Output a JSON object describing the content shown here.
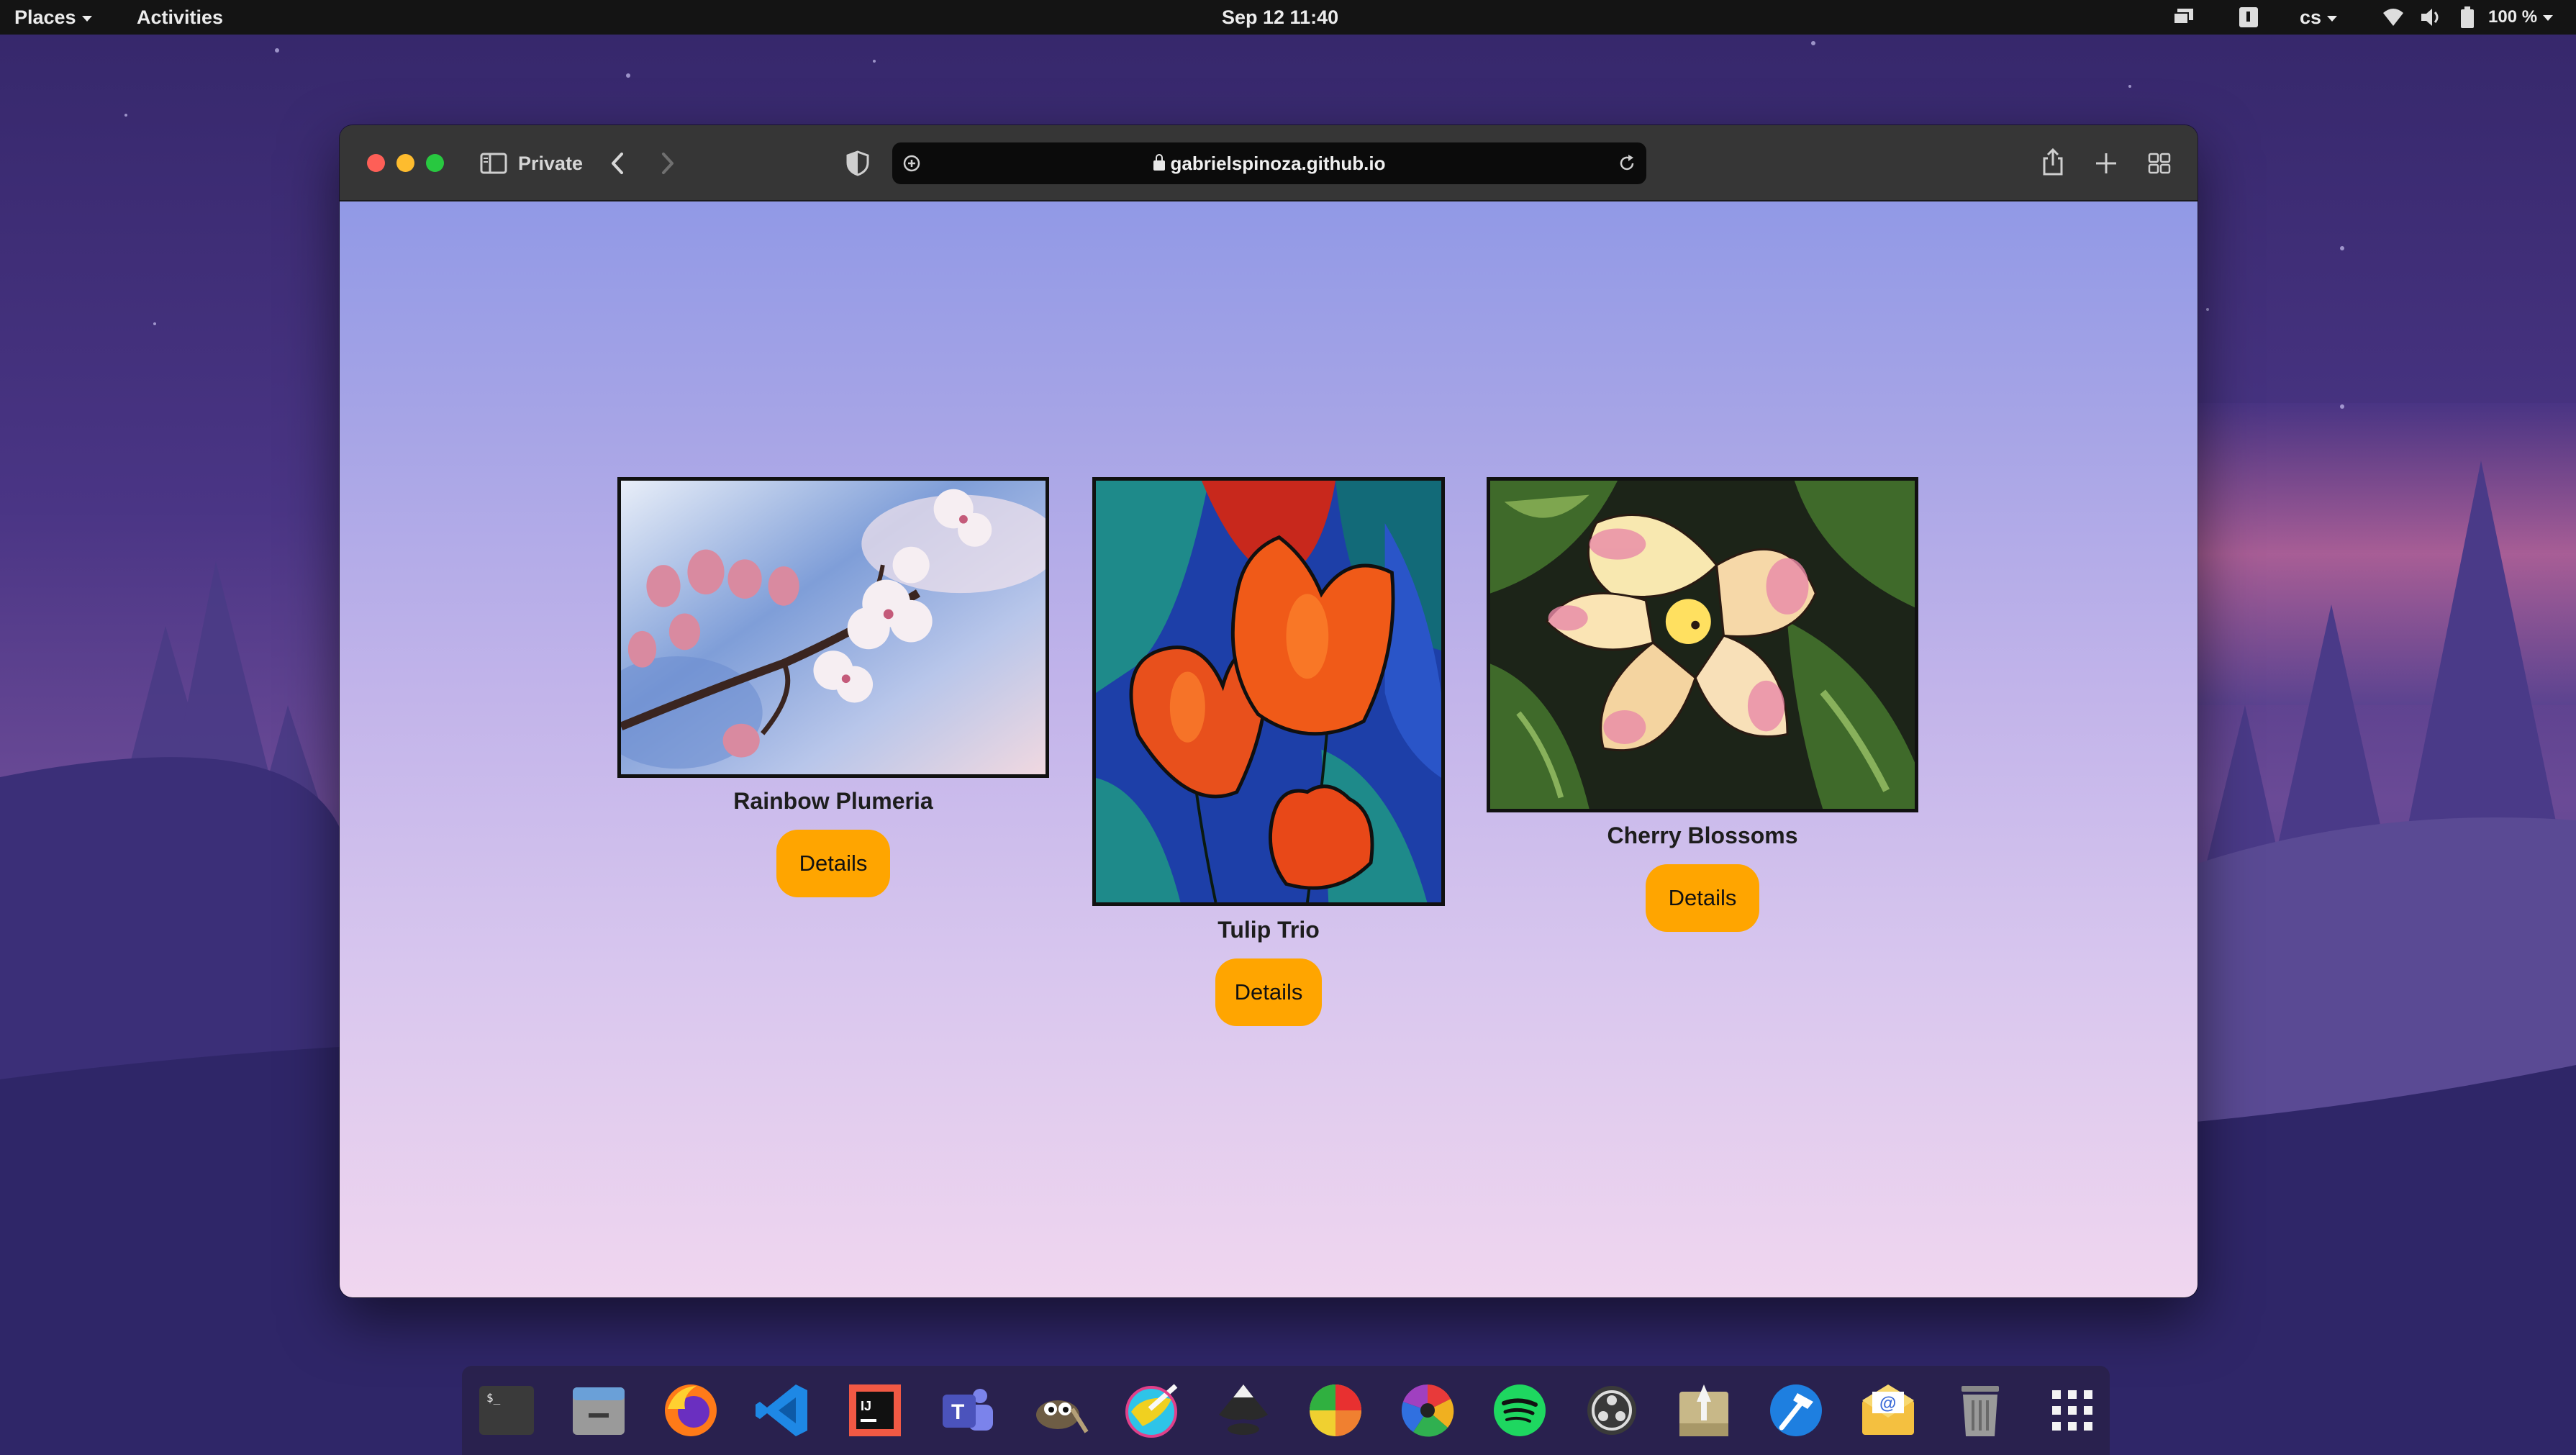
{
  "topbar": {
    "places_label": "Places",
    "activities_label": "Activities",
    "datetime": "Sep 12  11:40",
    "keyboard_layout": "cs",
    "battery_percent": "100 %",
    "icons": [
      "screens-icon",
      "notification-icon",
      "keyboard-layout-icon",
      "wifi-icon",
      "volume-icon",
      "battery-icon"
    ]
  },
  "browser": {
    "mode_label": "Private",
    "url": "gabrielspinoza.github.io",
    "toolbar_icons": [
      "sidebar-icon",
      "back-icon",
      "forward-icon",
      "privacy-shield-icon",
      "reload-icon",
      "share-icon",
      "new-tab-icon",
      "tab-overview-icon"
    ]
  },
  "gallery": {
    "items": [
      {
        "title": "Rainbow Plumeria",
        "button_label": "Details"
      },
      {
        "title": "Tulip Trio",
        "button_label": "Details"
      },
      {
        "title": "Cherry Blossoms",
        "button_label": "Details"
      }
    ]
  },
  "dock": {
    "apps": [
      "terminal-icon",
      "files-icon",
      "firefox-icon",
      "vscode-icon",
      "intellij-icon",
      "teams-icon",
      "gimp-icon",
      "krita-icon",
      "inkscape-icon",
      "color-picker-icon",
      "shotwell-icon",
      "spotify-icon",
      "obs-icon",
      "app-installer-icon",
      "xcode-icon",
      "mail-icon",
      "trash-icon",
      "app-grid-icon"
    ]
  },
  "colors": {
    "accent_button": "#ffa500",
    "page_gradient_top": "#9199e6",
    "page_gradient_bottom": "#f0d6ef",
    "topbar": "#141414"
  }
}
